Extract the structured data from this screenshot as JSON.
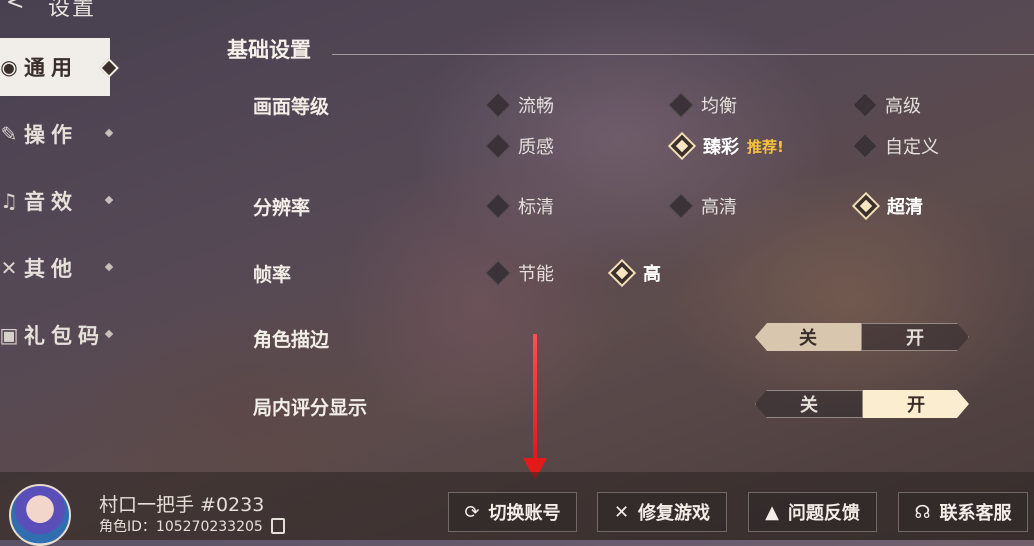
{
  "header": {
    "title": "设置",
    "back_icon": "chevron-left-icon"
  },
  "sidebar": {
    "items": [
      {
        "label": "通用",
        "icon": "general-icon",
        "active": true
      },
      {
        "label": "操作",
        "icon": "controls-icon",
        "active": false
      },
      {
        "label": "音效",
        "icon": "audio-icon",
        "active": false
      },
      {
        "label": "其他",
        "icon": "tools-icon",
        "active": false
      },
      {
        "label": "礼包码",
        "icon": "gift-icon",
        "active": false
      }
    ]
  },
  "section": {
    "title": "基础设置"
  },
  "settings": {
    "graphics": {
      "label": "画面等级",
      "options": [
        "流畅",
        "均衡",
        "高级",
        "质感",
        "臻彩",
        "自定义"
      ],
      "selected": "臻彩",
      "recommended_badge": "推荐!"
    },
    "resolution": {
      "label": "分辨率",
      "options": [
        "标清",
        "高清",
        "超清"
      ],
      "selected": "超清"
    },
    "framerate": {
      "label": "帧率",
      "options": [
        "节能",
        "高"
      ],
      "selected": "高"
    },
    "outline": {
      "label": "角色描边",
      "off_label": "关",
      "on_label": "开",
      "value": "关"
    },
    "score_display": {
      "label": "局内评分显示",
      "off_label": "关",
      "on_label": "开",
      "value": "开"
    }
  },
  "player": {
    "name": "村口一把手 #0233",
    "role_id": "角色ID：105270233205"
  },
  "actions": {
    "switch_account": "切换账号",
    "repair_game": "修复游戏",
    "feedback": "问题反馈",
    "contact_support": "联系客服"
  },
  "colors": {
    "accent_cream": "#fbeed0",
    "badge_yellow": "#f6c23c",
    "annotation_red": "#e31a1a"
  }
}
